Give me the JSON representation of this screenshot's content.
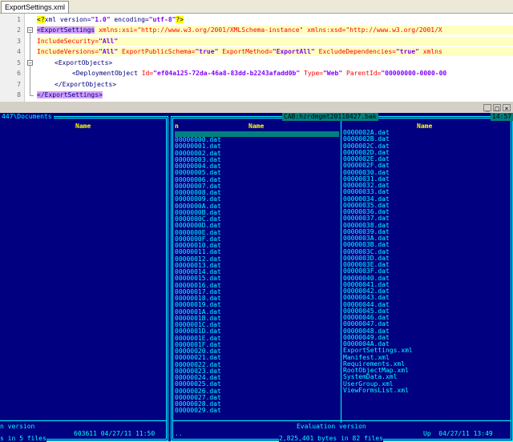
{
  "editor": {
    "tab_label": "ExportSettings.xml",
    "line_numbers": [
      "1",
      "2",
      "3",
      "4",
      "5",
      "6",
      "7",
      "8"
    ],
    "lines": {
      "l1": {
        "open": "<?",
        "a": "xml version",
        "b": "=",
        "c": "\"1.0\"",
        "d": " encoding",
        "e": "=",
        "f": "\"utf-8\"",
        "close": "?>"
      },
      "l2": {
        "tag": "<ExportSettings",
        "rest": " xmlns:xsi=\"http://www.w3.org/2001/XMLSchema-instance\" xmlns:xsd=\"http://www.w3.org/2001/X"
      },
      "l3": {
        "attr": "IncludeSecurity=",
        "val": "\"All\""
      },
      "l4": {
        "attr1": "IncludeVersions=",
        "val1": "\"All\"",
        "attr2": " ExportPublicSchema=",
        "val2": "\"true\"",
        "attr3": " ExportMethod=",
        "val3": "\"ExportAll\"",
        "attr4": " ExcludeDependencies=",
        "val4": "\"true\"",
        "tail": " xmlns"
      },
      "l5": {
        "text": "<ExportObjects>"
      },
      "l6": {
        "tag": "<DeploymentObject",
        "a1": " Id=",
        "v1": "\"ef04a125-72da-46a8-83dd-b2243afadd0b\"",
        "a2": " Type=",
        "v2": "\"Web\"",
        "a3": " ParentId=",
        "v3": "\"00000000-0000-00"
      },
      "l7": {
        "text": "</ExportObjects>"
      },
      "l8": {
        "text": "</ExportSettings>"
      }
    }
  },
  "far": {
    "window_buttons": {
      "min": "_",
      "max": "□",
      "close": "×"
    },
    "left_panel": {
      "title": "447\\Documents",
      "col_name": "Name",
      "footer": "n version",
      "footer_info": "603611 04/27/11 11:50",
      "bottom": "s in 5 files"
    },
    "right_panel": {
      "title": "CAB:hzrdmgmt20110427.bak",
      "clock": "14:57",
      "col_n": "n",
      "col_name1": "Name",
      "col_name2": "Name",
      "footer": "Evaluation version",
      "dotdot": "..",
      "up_info": "Up  04/27/11 13:49",
      "bottom": "2,825,401 bytes in 82 files",
      "col1_files": [
        "00000000.dat",
        "00000001.dat",
        "00000002.dat",
        "00000003.dat",
        "00000004.dat",
        "00000005.dat",
        "00000006.dat",
        "00000007.dat",
        "00000008.dat",
        "00000009.dat",
        "0000000A.dat",
        "0000000B.dat",
        "0000000C.dat",
        "0000000D.dat",
        "0000000E.dat",
        "0000000F.dat",
        "00000010.dat",
        "00000011.dat",
        "00000012.dat",
        "00000013.dat",
        "00000014.dat",
        "00000015.dat",
        "00000016.dat",
        "00000017.dat",
        "00000018.dat",
        "00000019.dat",
        "0000001A.dat",
        "0000001B.dat",
        "0000001C.dat",
        "0000001D.dat",
        "0000001E.dat",
        "0000001F.dat",
        "00000020.dat",
        "00000021.dat",
        "00000022.dat",
        "00000023.dat",
        "00000024.dat",
        "00000025.dat",
        "00000026.dat",
        "00000027.dat",
        "00000028.dat",
        "00000029.dat"
      ],
      "col2_files": [
        "0000002A.dat",
        "0000002B.dat",
        "0000002C.dat",
        "0000002D.dat",
        "0000002E.dat",
        "0000002F.dat",
        "00000030.dat",
        "00000031.dat",
        "00000032.dat",
        "00000033.dat",
        "00000034.dat",
        "00000035.dat",
        "00000036.dat",
        "00000037.dat",
        "00000038.dat",
        "00000039.dat",
        "0000003A.dat",
        "0000003B.dat",
        "0000003C.dat",
        "0000003D.dat",
        "0000003E.dat",
        "0000003F.dat",
        "00000040.dat",
        "00000041.dat",
        "00000042.dat",
        "00000043.dat",
        "00000044.dat",
        "00000045.dat",
        "00000046.dat",
        "00000047.dat",
        "00000048.dat",
        "00000049.dat",
        "0000004A.dat",
        "ExportSettings.xml",
        "Manifest.xml",
        "Requirements.xml",
        "RootObjectMap.xml",
        "SystemData.xml",
        "UserGroup.xml",
        "ViewFormsList.xml"
      ]
    }
  }
}
